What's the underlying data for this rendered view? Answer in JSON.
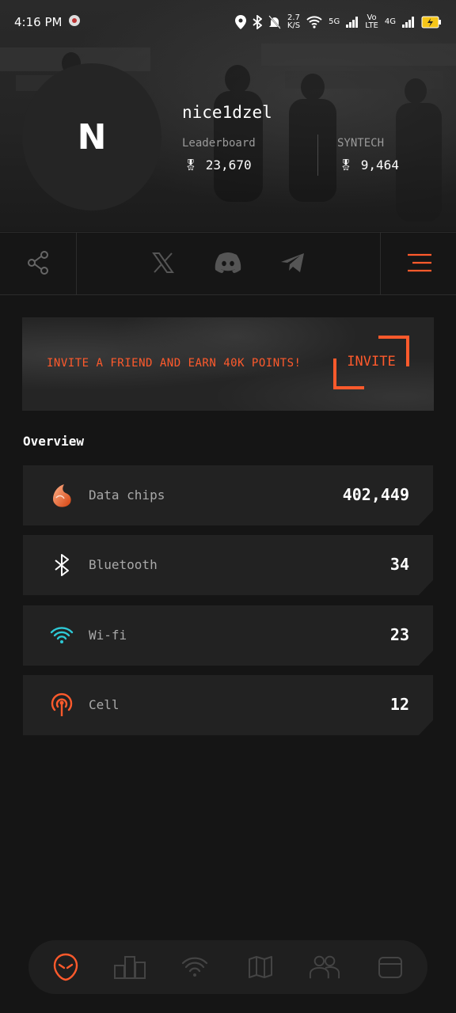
{
  "status_bar": {
    "time": "4:16 PM",
    "net_speed_value": "2.7",
    "net_speed_unit": "K/S",
    "sim1_type": "5G",
    "volte_top": "Vo",
    "volte_bottom": "LTE",
    "sim2_type": "4G",
    "icons": [
      "location-icon",
      "bluetooth-icon",
      "mute-icon",
      "wifi-icon",
      "signal-icon",
      "battery-icon"
    ]
  },
  "profile": {
    "avatar_letter": "N",
    "username": "nice1dzel",
    "stats": [
      {
        "label": "Leaderboard",
        "value": "23,670"
      },
      {
        "label": "SYNTECH",
        "value": "9,464"
      }
    ]
  },
  "social": {
    "icons": [
      "share-icon",
      "x-icon",
      "discord-icon",
      "telegram-icon",
      "menu-icon"
    ]
  },
  "invite": {
    "text": "INVITE A FRIEND AND EARN 40K POINTS!",
    "button_label": "INVITE"
  },
  "overview": {
    "title": "Overview",
    "items": [
      {
        "label": "Data chips",
        "value": "402,449",
        "icon": "data-chip-icon"
      },
      {
        "label": "Bluetooth",
        "value": "34",
        "icon": "bluetooth-icon"
      },
      {
        "label": "Wi-fi",
        "value": "23",
        "icon": "wifi-icon"
      },
      {
        "label": "Cell",
        "value": "12",
        "icon": "cell-tower-icon"
      }
    ]
  },
  "colors": {
    "accent": "#ff5a2c",
    "wifi": "#2ec9d6",
    "background": "#151515",
    "card": "#222222"
  },
  "bottom_nav": {
    "items": [
      "alien-home-icon",
      "leaderboard-icon",
      "wifi-scan-icon",
      "map-icon",
      "team-icon",
      "wallet-icon"
    ],
    "active": "alien-home-icon"
  }
}
